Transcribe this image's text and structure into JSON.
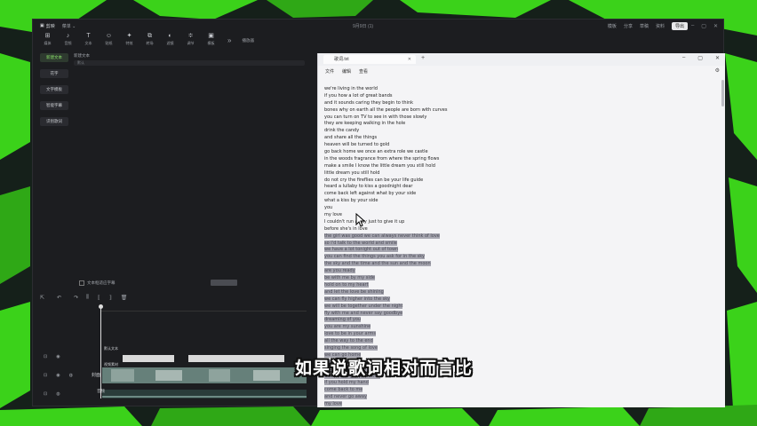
{
  "colors": {
    "accent_green": "#3bd21a",
    "dark_bg": "#15201a",
    "notepad_bg": "#f4f4f6",
    "selection": "#a6a6b0"
  },
  "editor": {
    "titlebar": {
      "logo": "剪映",
      "menu": "菜单 ⌄",
      "title": "9月9日 (1)",
      "right_items": [
        "模板",
        "分享",
        "草稿",
        "资料"
      ],
      "export": "导出"
    },
    "toolbar": [
      {
        "icon": "import-icon",
        "glyph": "⊞",
        "label": "媒体"
      },
      {
        "icon": "audio-icon",
        "glyph": "♪",
        "label": "音频"
      },
      {
        "icon": "text-icon",
        "glyph": "T",
        "label": "文本"
      },
      {
        "icon": "sticker-icon",
        "glyph": "☺",
        "label": "贴纸"
      },
      {
        "icon": "effects-icon",
        "glyph": "✦",
        "label": "特效"
      },
      {
        "icon": "transition-icon",
        "glyph": "⧉",
        "label": "转场"
      },
      {
        "icon": "filter-icon",
        "glyph": "◐",
        "label": "滤镜"
      },
      {
        "icon": "adjust-icon",
        "glyph": "≑",
        "label": "调节"
      },
      {
        "icon": "template-icon",
        "glyph": "▣",
        "label": "模板"
      }
    ],
    "toolbar_player": "播放器",
    "sidebar": [
      "新建文本",
      "花字",
      "文字模板",
      "智能字幕",
      "识别歌词"
    ],
    "panel": {
      "heading": "新建文本",
      "input_placeholder": "默认"
    },
    "option_label": "文本框适应字幕",
    "tracks": {
      "text_clip_label": "默认文本",
      "video_clip_label": "视频素材",
      "cover_label": "封面",
      "audio_clip_label": "音频"
    }
  },
  "notepad": {
    "tab_title": "歌词.txt",
    "menu": [
      "文件",
      "编辑",
      "查看"
    ],
    "lines": [
      {
        "text": "we're living in the world",
        "sel": false
      },
      {
        "text": "if you how a lot of great bands",
        "sel": false
      },
      {
        "text": "and it sounds caring they begin to think",
        "sel": false
      },
      {
        "text": "bones why on earth all the people are born with curves",
        "sel": false
      },
      {
        "text": "you can turn on TV to see in with those slowly",
        "sel": false
      },
      {
        "text": "they are keeping walking in the hole",
        "sel": false
      },
      {
        "text": "drink the candy",
        "sel": false
      },
      {
        "text": "and share all the things",
        "sel": false
      },
      {
        "text": "heaven will be turned to gold",
        "sel": false
      },
      {
        "text": "go back home we once an extra role we castle",
        "sel": false
      },
      {
        "text": "in the woods fragrance from where the spring flows",
        "sel": false
      },
      {
        "text": "make a smile I know the little dream you still hold",
        "sel": false
      },
      {
        "text": "little dream you still hold",
        "sel": false
      },
      {
        "text": "do not cry the fireflies can be your life guide",
        "sel": false
      },
      {
        "text": "heard a lullaby to kiss a goodnight dear",
        "sel": false
      },
      {
        "text": "come back left against what by your side",
        "sel": false
      },
      {
        "text": "what a kiss by your side",
        "sel": false
      },
      {
        "text": "you",
        "sel": false
      },
      {
        "text": "my love",
        "sel": false
      },
      {
        "text": "I couldn't run away just to give it up",
        "sel": false
      },
      {
        "text": "before she's in love",
        "sel": false
      },
      {
        "text": "the girl was good we can always never think of love",
        "sel": true
      },
      {
        "text": "so I'd talk to the world and smile",
        "sel": true
      },
      {
        "text": "we have a lot tonight out of town",
        "sel": true
      },
      {
        "text": "you can find the things you ask for in the sky",
        "sel": true
      },
      {
        "text": "the sky and the time and the sun and the moon",
        "sel": true
      },
      {
        "text": "are you ready",
        "sel": true
      },
      {
        "text": "be with me by my side",
        "sel": true
      },
      {
        "text": "hold on to my heart",
        "sel": true
      },
      {
        "text": "and let the love be shining",
        "sel": true
      },
      {
        "text": "we can fly higher into the sky",
        "sel": true
      },
      {
        "text": "we will be together under the night",
        "sel": true
      },
      {
        "text": "fly with me and never say goodbye",
        "sel": true
      },
      {
        "text": "dreaming of you",
        "sel": true
      },
      {
        "text": "you are my sunshine",
        "sel": true
      },
      {
        "text": "love to be in your arms",
        "sel": true
      },
      {
        "text": "all the way to the end",
        "sel": true
      },
      {
        "text": "singing the song of love",
        "sel": true
      },
      {
        "text": "we can go home",
        "sel": true
      },
      {
        "text": "the day is over",
        "sel": true
      },
      {
        "text": "you are the light in my heart",
        "sel": true
      },
      {
        "text": "we are living in the world",
        "sel": true
      },
      {
        "text": "if you hold my hand",
        "sel": true
      },
      {
        "text": "come back to me",
        "sel": true
      },
      {
        "text": "and never go away",
        "sel": true
      },
      {
        "text": "my love",
        "sel": true
      }
    ]
  },
  "subtitle": "如果说歌词相对而言比"
}
